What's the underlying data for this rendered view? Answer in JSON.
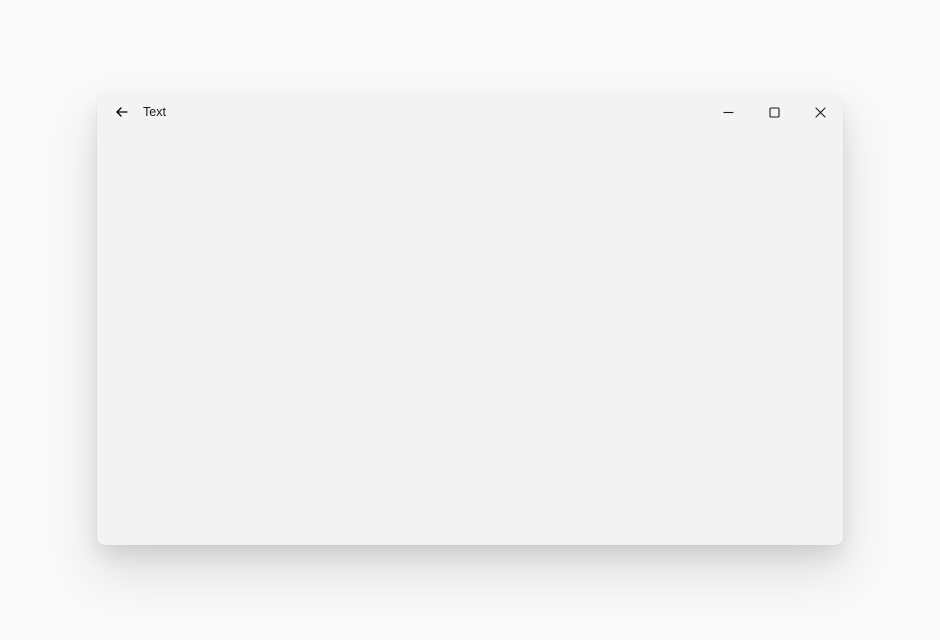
{
  "window": {
    "title": "Text"
  }
}
